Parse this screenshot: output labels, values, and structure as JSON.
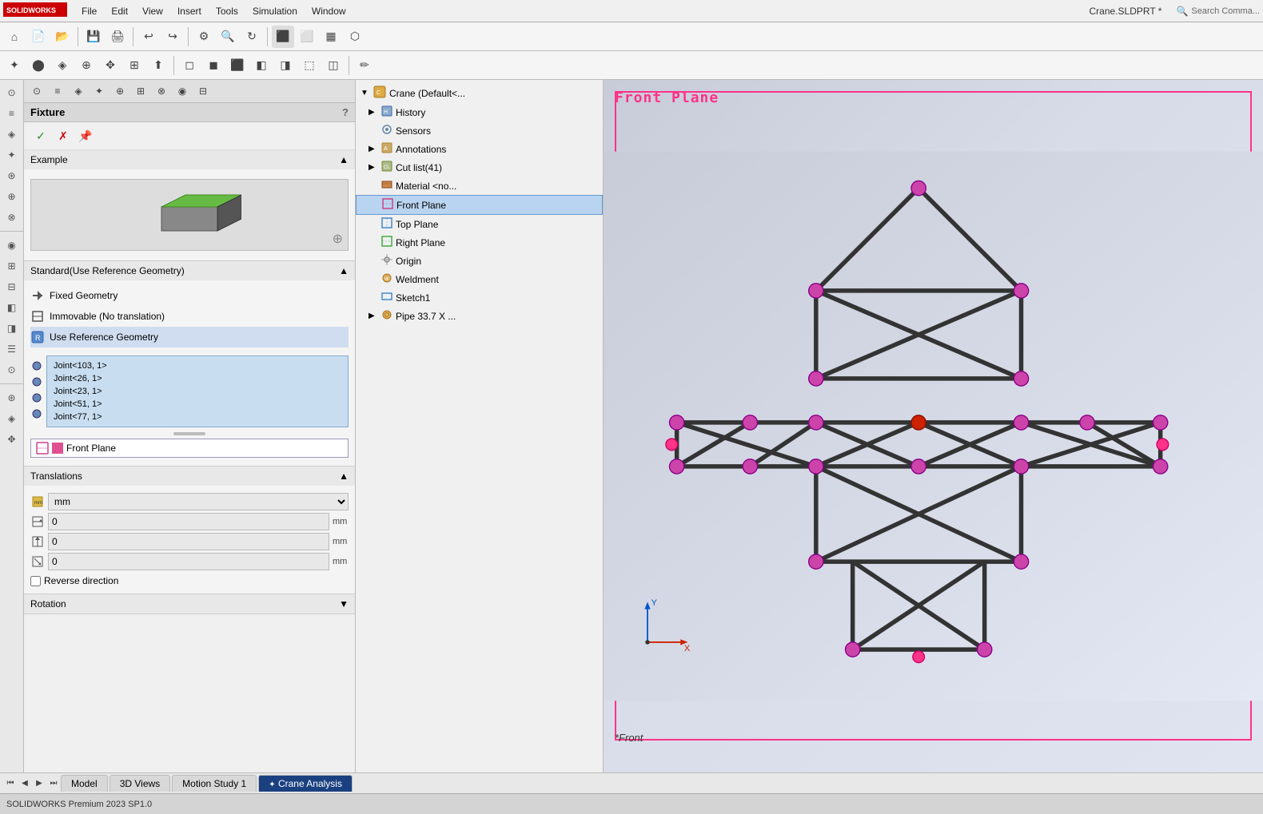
{
  "app": {
    "logo_text": "SOLIDWORKS",
    "title": "Crane.SLDPRT *",
    "search_placeholder": "Search Comma..."
  },
  "menu": {
    "items": [
      "File",
      "Edit",
      "View",
      "Insert",
      "Tools",
      "Simulation",
      "Window"
    ]
  },
  "left_panel": {
    "title": "Fixture",
    "help_label": "?",
    "actions": {
      "confirm": "✓",
      "cancel": "✗",
      "pin": "📌"
    },
    "example_section": {
      "label": "Example",
      "collapsed": false
    },
    "standard_section": {
      "label": "Standard(Use Reference Geometry)",
      "items": [
        "Fixed Geometry",
        "Immovable (No translation)",
        "Use Reference Geometry"
      ]
    },
    "joint_list": {
      "items": [
        "Joint<103, 1>",
        "Joint<26, 1>",
        "Joint<23, 1>",
        "Joint<51, 1>",
        "Joint<77, 1>"
      ]
    },
    "plane_selector": {
      "label": "Front Plane",
      "color": "#e05090"
    },
    "translations_section": {
      "label": "Translations",
      "unit": "mm",
      "values": [
        "0",
        "0",
        "0"
      ],
      "reverse_label": "Reverse direction"
    },
    "rotation_section": {
      "label": "Rotation",
      "collapsed": false
    }
  },
  "feature_tree": {
    "root": "Crane (Default<...",
    "items": [
      {
        "id": "history",
        "label": "History",
        "indent": 1,
        "expandable": true
      },
      {
        "id": "sensors",
        "label": "Sensors",
        "indent": 1,
        "expandable": false
      },
      {
        "id": "annotations",
        "label": "Annotations",
        "indent": 1,
        "expandable": true
      },
      {
        "id": "cutlist",
        "label": "Cut list(41)",
        "indent": 1,
        "expandable": true
      },
      {
        "id": "material",
        "label": "Material <no...",
        "indent": 1,
        "expandable": false
      },
      {
        "id": "frontplane",
        "label": "Front Plane",
        "indent": 1,
        "selected": true
      },
      {
        "id": "topplane",
        "label": "Top Plane",
        "indent": 1
      },
      {
        "id": "rightplane",
        "label": "Right Plane",
        "indent": 1
      },
      {
        "id": "origin",
        "label": "Origin",
        "indent": 1
      },
      {
        "id": "weldment",
        "label": "Weldment",
        "indent": 1
      },
      {
        "id": "sketch1",
        "label": "Sketch1",
        "indent": 1
      },
      {
        "id": "pipe",
        "label": "Pipe 33.7 X ...",
        "indent": 1,
        "expandable": true
      }
    ]
  },
  "viewport": {
    "label": "Front Plane",
    "view_label": "*Front",
    "border_color": "#ff3388"
  },
  "bottom_tabs": {
    "items": [
      {
        "label": "Model",
        "active": false
      },
      {
        "label": "3D Views",
        "active": false
      },
      {
        "label": "Motion Study 1",
        "active": false
      },
      {
        "label": "Crane Analysis",
        "active": true,
        "special": true
      }
    ]
  },
  "status_bar": {
    "text": "SOLIDWORKS Premium 2023 SP1.0"
  },
  "icons": {
    "expand": "▶",
    "collapse": "▼",
    "check": "✓",
    "cross": "✗",
    "chevron_down": "▼",
    "chevron_right": "▶"
  }
}
